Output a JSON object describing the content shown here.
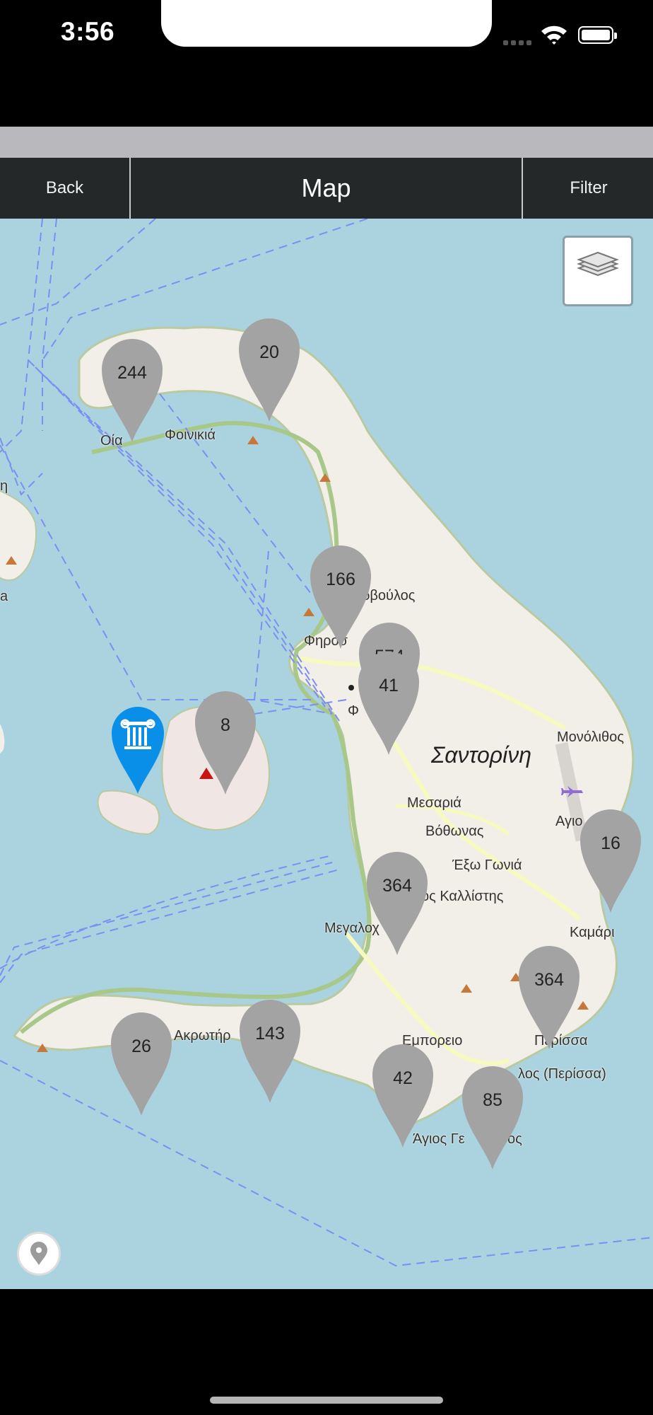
{
  "status_bar": {
    "time": "3:56"
  },
  "nav": {
    "back_label": "Back",
    "title": "Map",
    "filter_label": "Filter"
  },
  "map": {
    "place_labels": {
      "oia": "Οία",
      "finikia": "Φοινικιά",
      "imerovigli": "ρβούλος",
      "fira_partial": "Φηροσ",
      "fira_letter": "Φ",
      "santorini": "Σαντορίνη",
      "monolithos": "Μονόλιθος",
      "mesaria": "Μεσαριά",
      "vothonas": "Βόθωνας",
      "exo_gonia": "Έξω Γωνιά",
      "kallisti": "ος Καλλίστης",
      "agios": "Αγιο",
      "megalochori": "Μεγαλοχ",
      "kamari": "Καμάρι",
      "akrotiri": "Ακρωτήρ",
      "emporio": "Εμπορειο",
      "perissa": "Περίσσα",
      "perivolos": "λος (Περίσσα)",
      "agios_georgios": "Άγιος Γε",
      "agios_georgios_end": "ος",
      "left_edge_1": "η",
      "left_edge_2": "a"
    },
    "clusters": [
      {
        "id": "c244",
        "count": "244"
      },
      {
        "id": "c20",
        "count": "20"
      },
      {
        "id": "c166",
        "count": "166"
      },
      {
        "id": "c574",
        "count": "574"
      },
      {
        "id": "c41",
        "count": "41"
      },
      {
        "id": "c8",
        "count": "8"
      },
      {
        "id": "c16",
        "count": "16"
      },
      {
        "id": "c364a",
        "count": "364"
      },
      {
        "id": "c364b",
        "count": "364"
      },
      {
        "id": "c26",
        "count": "26"
      },
      {
        "id": "c143",
        "count": "143"
      },
      {
        "id": "c42",
        "count": "42"
      },
      {
        "id": "c85",
        "count": "85"
      }
    ],
    "poi": {
      "icon": "ancient-column-icon",
      "color": "#0a8fe8"
    },
    "cluster_color": "#a3a3a3",
    "water_color": "#aad3df",
    "land_color": "#f2efe9"
  }
}
